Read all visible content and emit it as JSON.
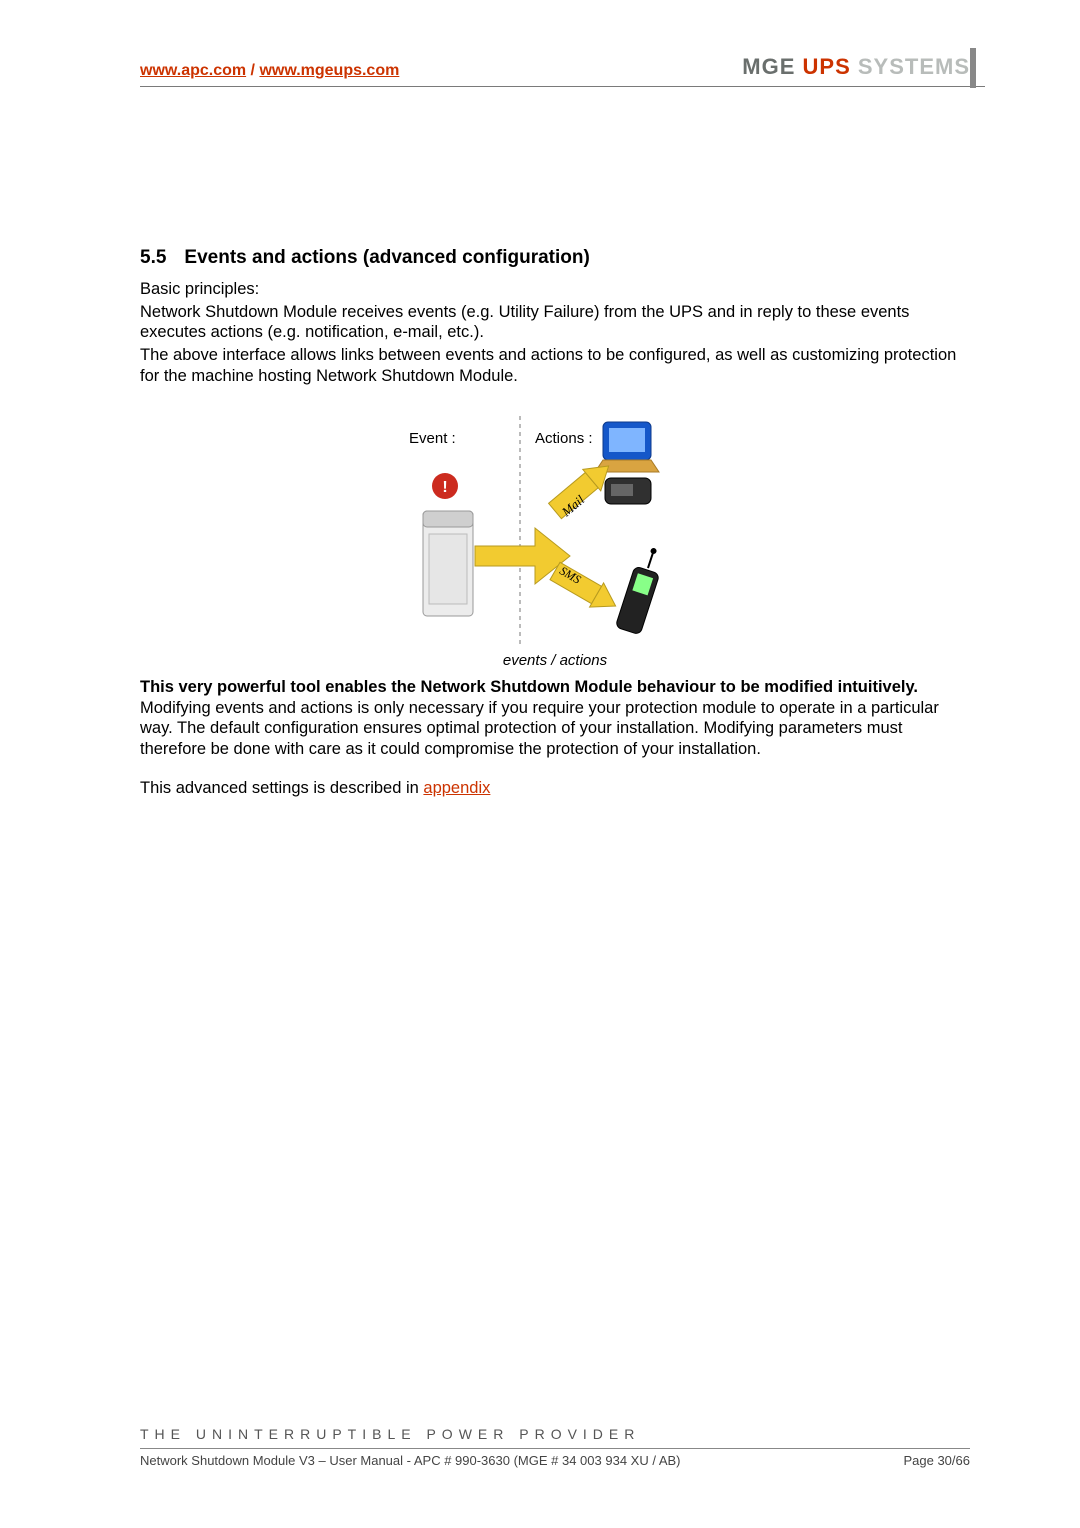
{
  "header": {
    "link1_text": "www.apc.com",
    "link1_href": "http://www.apc.com",
    "slash": " / ",
    "link2_text": "www.mgeups.com",
    "link2_href": "http://www.mgeups.com",
    "brand_mge": "MGE",
    "brand_ups": " UPS ",
    "brand_sys": "SYSTEMS"
  },
  "section": {
    "number": "5.5",
    "title": "Events and actions (advanced configuration)"
  },
  "para1": "Basic principles:",
  "para2": "Network Shutdown Module receives events (e.g. Utility Failure) from the UPS and in reply to these events executes actions (e.g. notification, e-mail, etc.).",
  "para3": "The above interface allows links between events and actions to be configured, as well as customizing protection for the machine hosting Network Shutdown Module.",
  "diagram": {
    "event_label": "Event :",
    "actions_label": "Actions :",
    "mail_label": "Mail",
    "sms_label": "SMS",
    "caption": "events / actions"
  },
  "para4_bold": "This very powerful tool enables the Network Shutdown Module behaviour to be modified intuitively.",
  "para5": "Modifying events and actions is only necessary if you require your protection module to operate in a particular way. The default configuration ensures optimal protection of your installation. Modifying parameters must therefore be done with care as it could compromise the protection of your installation.",
  "para6_prefix": "This advanced settings is described in ",
  "para6_link": "appendix",
  "footer": {
    "tagline": "THE UNINTERRUPTIBLE POWER PROVIDER",
    "doc": "Network Shutdown Module V3 – User Manual - APC # 990-3630 (MGE # 34 003 934 XU / AB)",
    "page": "Page 30/66"
  }
}
